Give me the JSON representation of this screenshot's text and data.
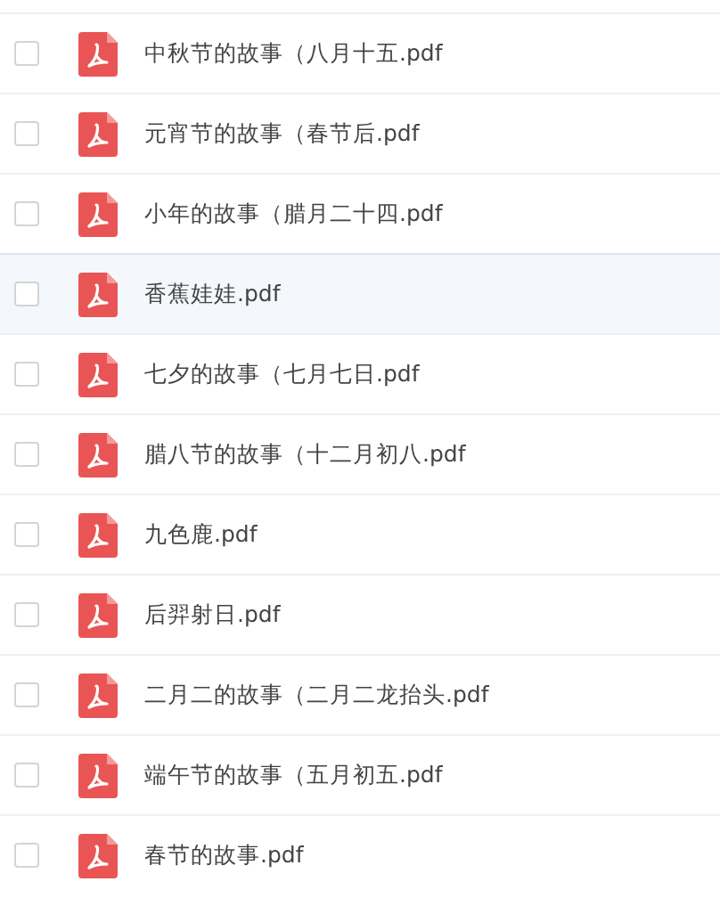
{
  "files": [
    {
      "name": "中秋节的故事（八月十五.pdf",
      "checked": false,
      "highlighted": false
    },
    {
      "name": "元宵节的故事（春节后.pdf",
      "checked": false,
      "highlighted": false
    },
    {
      "name": "小年的故事（腊月二十四.pdf",
      "checked": false,
      "highlighted": false
    },
    {
      "name": "香蕉娃娃.pdf",
      "checked": false,
      "highlighted": true
    },
    {
      "name": "七夕的故事（七月七日.pdf",
      "checked": false,
      "highlighted": false
    },
    {
      "name": "腊八节的故事（十二月初八.pdf",
      "checked": false,
      "highlighted": false
    },
    {
      "name": "九色鹿.pdf",
      "checked": false,
      "highlighted": false
    },
    {
      "name": "后羿射日.pdf",
      "checked": false,
      "highlighted": false
    },
    {
      "name": "二月二的故事（二月二龙抬头.pdf",
      "checked": false,
      "highlighted": false
    },
    {
      "name": "端午节的故事（五月初五.pdf",
      "checked": false,
      "highlighted": false
    },
    {
      "name": "春节的故事.pdf",
      "checked": false,
      "highlighted": false
    }
  ]
}
